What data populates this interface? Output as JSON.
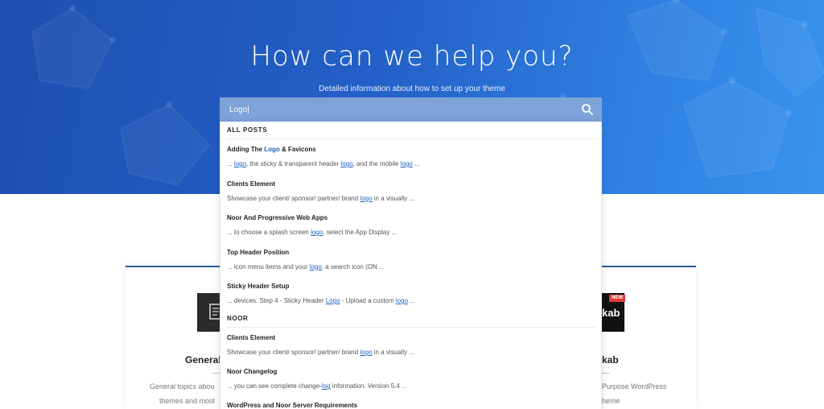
{
  "hero": {
    "title": "How can we help you?",
    "subtitle": "Detailed information about how to set up your theme"
  },
  "search": {
    "value": "Logo|"
  },
  "results": {
    "group1_label": "ALL POSTS",
    "group1": [
      {
        "title_pre": "Adding The ",
        "title_hl": "Logo",
        "title_post": " & Favicons",
        "snip": [
          [
            "... ",
            ""
          ],
          [
            "logo",
            "hl"
          ],
          [
            ", the sticky & transparent header ",
            ""
          ],
          [
            "logo",
            "hl"
          ],
          [
            ", and the mobile ",
            ""
          ],
          [
            "logo",
            "hl"
          ],
          [
            " ...",
            ""
          ]
        ]
      },
      {
        "title_pre": "Clients Element",
        "title_hl": "",
        "title_post": "",
        "snip": [
          [
            "Showcase your client/ sponsor/ partner/ brand ",
            ""
          ],
          [
            "logo",
            "hl"
          ],
          [
            " in a visually ...",
            ""
          ]
        ]
      },
      {
        "title_pre": "Noor And Progressive Web Apps",
        "title_hl": "",
        "title_post": "",
        "snip": [
          [
            "... to choose a splash screen ",
            ""
          ],
          [
            "logo",
            "hl"
          ],
          [
            ", select the App Display ...",
            ""
          ]
        ]
      },
      {
        "title_pre": "Top Header Position",
        "title_hl": "",
        "title_post": "",
        "snip": [
          [
            "... icon menu items and your ",
            ""
          ],
          [
            "logo",
            "hl"
          ],
          [
            ", a search icon (ON ...",
            ""
          ]
        ]
      },
      {
        "title_pre": "Sticky Header Setup",
        "title_hl": "",
        "title_post": "",
        "snip": [
          [
            "... devices. Step 4 - Sticky Header ",
            ""
          ],
          [
            "Logo",
            "hl"
          ],
          [
            " - Upload a custom ",
            ""
          ],
          [
            "logo",
            "hl"
          ],
          [
            " ...",
            ""
          ]
        ]
      }
    ],
    "group2_label": "NOOR",
    "group2": [
      {
        "title_pre": "Clients Element",
        "title_hl": "",
        "title_post": "",
        "snip": [
          [
            "Showcase your client/ sponsor/ partner/ brand ",
            ""
          ],
          [
            "logo",
            "hl"
          ],
          [
            " in a visually ...",
            ""
          ]
        ]
      },
      {
        "title_pre": "Noor Changelog",
        "title_hl": "",
        "title_post": "",
        "snip": [
          [
            "... you can see complete change-",
            ""
          ],
          [
            "log",
            "hl"
          ],
          [
            " information. Version 5.4 ...",
            ""
          ]
        ]
      },
      {
        "title_pre": "WordPress and Noor Server Requirements",
        "title_hl": "",
        "title_post": "",
        "snip": []
      }
    ]
  },
  "card": {
    "left_title": "General",
    "left_desc1": "General topics abou",
    "left_desc2": "themes and most",
    "right_title": "kab",
    "right_desc1": "Purpose WordPress",
    "right_desc2": "heme",
    "badge": "NEW",
    "right_logo_text": "kab"
  },
  "colors": {
    "hero_start": "#1e4fb0",
    "hero_end": "#3a93ee",
    "search_bar": "#7ea3d8",
    "highlight": "#1f5fbf",
    "card_top": "#2b5c9c"
  },
  "icons": {
    "search": "search-icon",
    "doc": "document-icon"
  }
}
